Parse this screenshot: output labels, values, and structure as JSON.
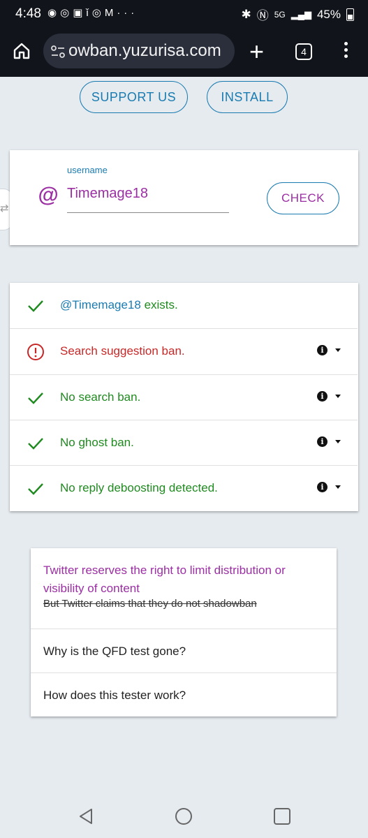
{
  "status_bar": {
    "time": "4:48",
    "app_icons": [
      "discord-icon",
      "instagram-icon",
      "twitch-icon",
      "info-icon",
      "instagram-icon",
      "gmail-icon",
      "more-icon"
    ],
    "battery": "45%",
    "network": "5G"
  },
  "browser": {
    "url": "owban.yuzurisa.com",
    "tab_count": "4"
  },
  "top_buttons": {
    "support": "SUPPORT US",
    "install": "INSTALL"
  },
  "search": {
    "label": "username",
    "value": "Timemage18",
    "at_symbol": "@",
    "check_label": "CHECK"
  },
  "results": [
    {
      "status": "ok",
      "handle": "@Timemage18",
      "text": " exists.",
      "has_info": false
    },
    {
      "status": "warn",
      "text": "Search suggestion ban.",
      "has_info": true
    },
    {
      "status": "ok",
      "text": "No search ban.",
      "has_info": true
    },
    {
      "status": "ok",
      "text": "No ghost ban.",
      "has_info": true
    },
    {
      "status": "ok",
      "text": "No reply deboosting detected.",
      "has_info": true
    }
  ],
  "faq": {
    "title": "Twitter reserves the right to limit distribution or visibility of content",
    "subtitle_struck": "But Twitter claims that they do not shadowban",
    "items": [
      "Why is the QFD test gone?",
      "How does this tester work?"
    ]
  },
  "colors": {
    "accent_blue": "#1a7bb0",
    "purple": "#9b2ea3",
    "green": "#1f8a1f",
    "red": "#c62828"
  }
}
